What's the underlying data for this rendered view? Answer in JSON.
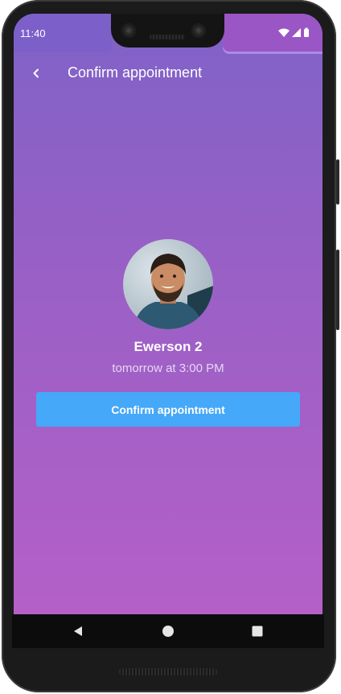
{
  "status_bar": {
    "time": "11:40",
    "icons": [
      "wifi-icon",
      "signal-icon",
      "battery-icon"
    ]
  },
  "app_bar": {
    "back_icon": "chevron-left-icon",
    "title": "Confirm appointment"
  },
  "provider": {
    "name": "Ewerson 2",
    "appointment_time": "tomorrow at 3:00 PM"
  },
  "actions": {
    "confirm_label": "Confirm appointment"
  },
  "nav_bar": {
    "icons": [
      "back-triangle-icon",
      "home-circle-icon",
      "recents-square-icon"
    ]
  },
  "colors": {
    "gradient_top": "#7f62c7",
    "gradient_bottom": "#b460c8",
    "confirm_button": "#45a8f8"
  }
}
